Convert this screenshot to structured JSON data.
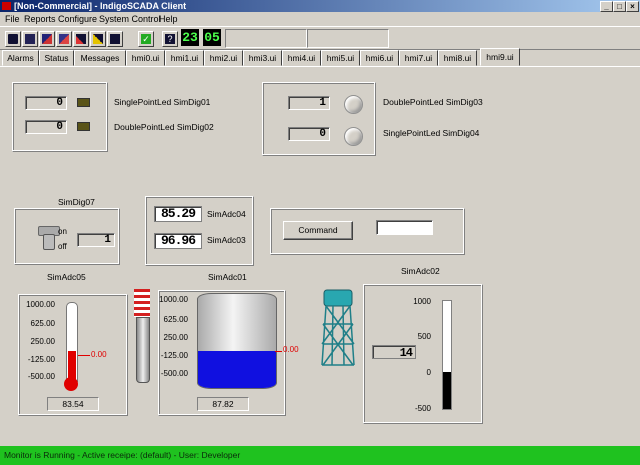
{
  "window": {
    "title": "[Non-Commercial] - IndigoSCADA Client",
    "min": "_",
    "max": "□",
    "close": "×"
  },
  "menu": [
    "File",
    "Reports",
    "Configure",
    "System Control",
    "Help"
  ],
  "toolbar": {
    "icons": [
      "printer-icon",
      "report-icon",
      "run-icon",
      "stop-icon",
      "disconnect-icon",
      "acknowledge-icon",
      "pause-icon",
      "check-icon",
      "help-icon"
    ],
    "clock_hours": "23",
    "clock_minutes": "05"
  },
  "tabs": [
    "Alarms",
    "Status",
    "Messages",
    "hmi0.ui",
    "hmi1.ui",
    "hmi2.ui",
    "hmi3.ui",
    "hmi4.ui",
    "hmi5.ui",
    "hmi6.ui",
    "hmi7.ui",
    "hmi8.ui",
    "hmi9.ui"
  ],
  "active_tab": "hmi9.ui",
  "panel1": {
    "rows": [
      {
        "value": "0",
        "label": "SinglePointLed SimDig01"
      },
      {
        "value": "0",
        "label": "DoublePointLed SimDig02"
      }
    ]
  },
  "panel2": {
    "rows": [
      {
        "value": "1",
        "label": "DoublePointLed SimDig03"
      },
      {
        "value": "0",
        "label": "SinglePointLed SimDig04"
      }
    ]
  },
  "switch": {
    "title": "SimDig07",
    "on_label": "on",
    "off_label": "off",
    "value": "1"
  },
  "lcds": [
    {
      "value": "85.29",
      "label": "SimAdc04"
    },
    {
      "value": "96.96",
      "label": "SimAdc03"
    }
  ],
  "command": {
    "button_label": "Command",
    "input_value": ""
  },
  "thermometer": {
    "title": "SimAdc05",
    "ticks": [
      "1000.00",
      "625.00",
      "250.00",
      "-125.00",
      "-500.00"
    ],
    "setpoint_label": "0.00",
    "value": "83.54",
    "level": 0.39
  },
  "tank": {
    "title": "SimAdc01",
    "ticks": [
      "1000.00",
      "625.00",
      "250.00",
      "-125.00",
      "-500.00"
    ],
    "setpoint_label": "0.00",
    "value": "87.82",
    "level": 0.39
  },
  "gauge": {
    "title": "SimAdc02",
    "ticks": [
      "1000",
      "500",
      "0",
      "-500"
    ],
    "value": "14",
    "level": 0.34
  },
  "colors": {
    "status_bar": "#1fc21f",
    "tank_fill": "#1010e0",
    "thermo_fill": "#e00000",
    "lcd_text": "#4cff4c"
  },
  "status": {
    "text": "Monitor is Running - Active receipe: (default) - User: Developer"
  }
}
